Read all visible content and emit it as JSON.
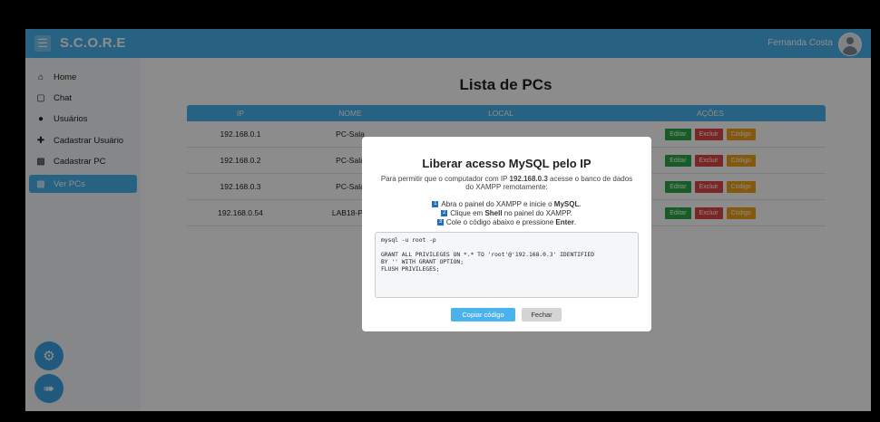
{
  "app": {
    "brand": "S.C.O.R.E",
    "user_name": "Fernanda Costa"
  },
  "sidebar": {
    "items": [
      {
        "label": "Home",
        "icon": "home-icon"
      },
      {
        "label": "Chat",
        "icon": "chat-icon"
      },
      {
        "label": "Usuários",
        "icon": "users-icon"
      },
      {
        "label": "Cadastrar Usuário",
        "icon": "add-user-icon"
      },
      {
        "label": "Cadastrar PC",
        "icon": "computer-icon"
      },
      {
        "label": "Ver PCs",
        "icon": "computer-icon",
        "active": true
      }
    ],
    "fab_settings_icon": "gear-icon",
    "fab_logout_icon": "logout-icon"
  },
  "main": {
    "title": "Lista de PCs",
    "table": {
      "headers": [
        "IP",
        "NOME",
        "LOCAL",
        "AÇÕES"
      ],
      "rows": [
        {
          "ip": "192.168.0.1",
          "nome": "PC-Sala"
        },
        {
          "ip": "192.168.0.2",
          "nome": "PC-Sala"
        },
        {
          "ip": "192.168.0.3",
          "nome": "PC-Sala"
        },
        {
          "ip": "192.168.0.54",
          "nome": "LAB18-PC"
        }
      ],
      "action_labels": {
        "edit": "Editar",
        "delete": "Excluir",
        "code": "Código"
      }
    }
  },
  "modal": {
    "title": "Liberar acesso MySQL pelo IP",
    "desc_prefix": "Para permitir que o computador com IP ",
    "desc_ip": "192.168.0.3",
    "desc_suffix": " acesse o banco de dados do XAMPP remotamente:",
    "step1_prefix": "Abra o painel do XAMPP e inicie o ",
    "step1_bold": "MySQL",
    "step1_suffix": ".",
    "step2_prefix": "Clique em ",
    "step2_bold": "Shell",
    "step2_suffix": " no painel do XAMPP.",
    "step3_prefix": "Cole o código abaixo e pressione ",
    "step3_bold": "Enter",
    "step3_suffix": ".",
    "code": "mysql -u root -p\n\nGRANT ALL PRIVILEGES ON *.* TO 'root'@'192.168.0.3' IDENTIFIED\nBY '' WITH GRANT OPTION;\nFLUSH PRIVILEGES;",
    "copy_label": "Copiar código",
    "close_label": "Fechar"
  }
}
